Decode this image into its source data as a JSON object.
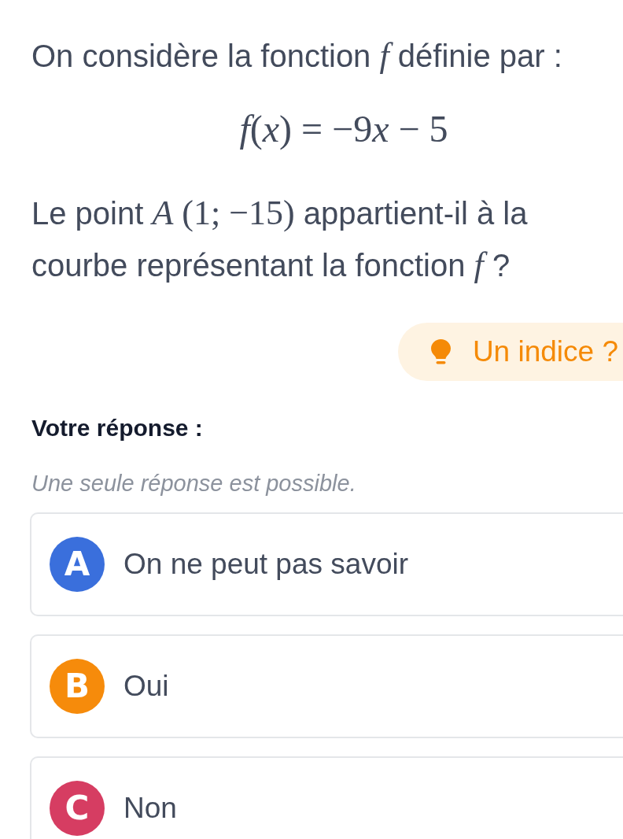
{
  "intro": [
    {
      "kind": "text",
      "text": "On considère la fonction "
    },
    {
      "kind": "math",
      "text": "*f*"
    },
    {
      "kind": "text",
      "text": " définie par :"
    }
  ],
  "formula": [
    {
      "kind": "var",
      "text": "f"
    },
    {
      "kind": "sym",
      "text": "("
    },
    {
      "kind": "var",
      "text": "x"
    },
    {
      "kind": "sym",
      "text": ") = −9"
    },
    {
      "kind": "var",
      "text": "x"
    },
    {
      "kind": "sym",
      "text": " − 5"
    }
  ],
  "question": [
    {
      "kind": "text",
      "text": "Le point "
    },
    {
      "kind": "math",
      "text": "*A* (1; −15)"
    },
    {
      "kind": "text",
      "text": " appartient-il à la courbe représentant la fonction "
    },
    {
      "kind": "math",
      "text": "*f*"
    },
    {
      "kind": "text",
      "text": " ?"
    }
  ],
  "hint_button": {
    "label": "Un indice ?"
  },
  "answer_title": "Votre réponse :",
  "answer_instruction": "Une seule réponse est possible.",
  "options": [
    {
      "letter": "A",
      "color": "#3a6fdc",
      "text": "On ne peut pas savoir",
      "selected": false
    },
    {
      "letter": "B",
      "color": "#f68b0b",
      "text": "Oui",
      "selected": false
    },
    {
      "letter": "C",
      "color": "#d63d62",
      "text": "Non",
      "selected": false
    }
  ]
}
